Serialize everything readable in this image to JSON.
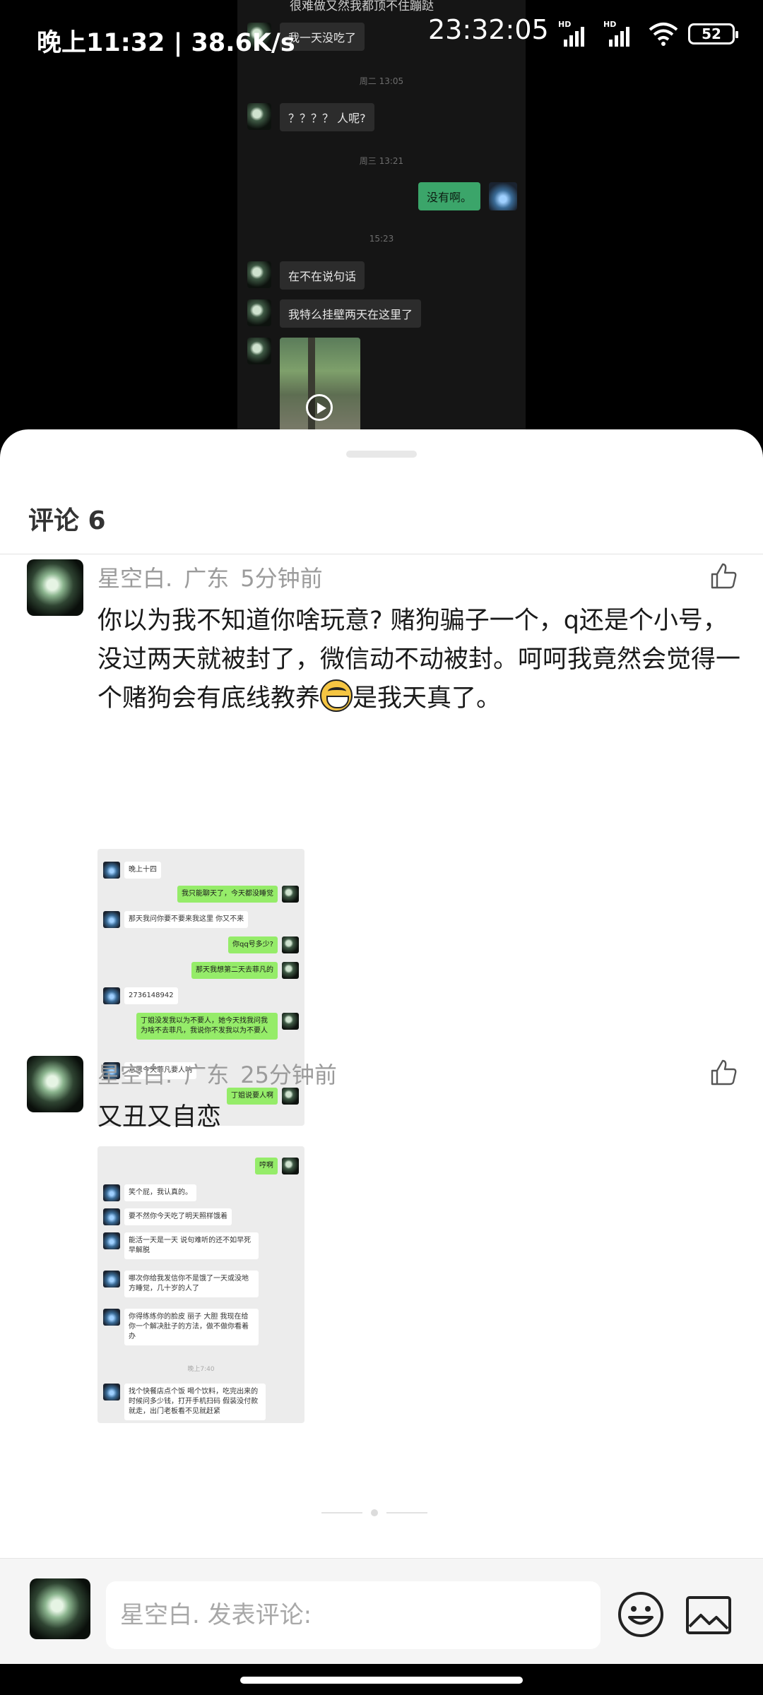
{
  "status_bar": {
    "left_text": "晚上11:32 | 38.6K/s",
    "clock": "23:32:05",
    "battery": "52",
    "signal_label": "HD"
  },
  "background_chat": {
    "top_text": "很难做又然我都顶不住蹦跶",
    "messages": [
      {
        "type": "text",
        "side": "left",
        "text": "我一天没吃了"
      },
      {
        "type": "time",
        "text": "周二 13:05"
      },
      {
        "type": "text",
        "side": "left",
        "text": "？？？？ 人呢?"
      },
      {
        "type": "time",
        "text": "周三 13:21"
      },
      {
        "type": "text",
        "side": "right",
        "text": "没有啊。"
      },
      {
        "type": "time",
        "text": "15:23"
      },
      {
        "type": "text",
        "side": "left",
        "text": "在不在说句话"
      },
      {
        "type": "text",
        "side": "left",
        "text": "我特么挂壁两天在这里了"
      }
    ]
  },
  "sheet": {
    "title": "评论 6"
  },
  "comments": [
    {
      "author": "星空白.",
      "location": "广东",
      "time": "5分钟前",
      "text_before_emoji": "你以为我不知道你啥玩意? 赌狗骗子一个，q还是个小号，没过两天就被封了，微信动不动被封。呵呵我竟然会觉得一个赌狗会有底线教养",
      "text_after_emoji": "是我天真了。",
      "image_messages": [
        "晚上十四",
        "我只能聊天了，今天都没睡觉",
        "那天我问你要不要来我这里 你又不来",
        "你qq号多少?",
        "那天我想第二天去菲凡的",
        "2736148942",
        "丁姐没发我以为不要人，她今天找我问我为啥不去菲凡，我说你不发我以为不要人",
        "意思今天菲凡要人呐",
        "丁姐说要人啊"
      ]
    },
    {
      "author": "星空白.",
      "location": "广东",
      "time": "25分钟前",
      "text": "又丑又自恋",
      "image_messages": [
        "哼啊",
        "笑个屁，我认真的。",
        "要不然你今天吃了明天照样饿着",
        "能活一天是一天 说句难听的还不如早死早解脱",
        "哪次你给我发信你不是饿了一天或没地方睡觉，几十岁的人了",
        "你得练练你的脸皮 丽子 大胆 我现在给你一个解决肚子的方法，做不做你看着办",
        "晚上7:40",
        "找个快餐店点个饭 喝个饮料，吃完出来的时候问多少钱，打开手机扫码 假装没付款就走，出门老板看不见就赶紧"
      ]
    }
  ],
  "input_bar": {
    "placeholder": "星空白. 发表评论:"
  }
}
